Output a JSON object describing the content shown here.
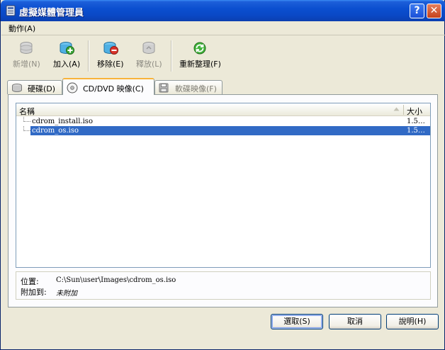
{
  "window": {
    "title": "虛擬媒體管理員",
    "help_glyph": "?",
    "close_glyph": "✕"
  },
  "menu": {
    "action": "動作(A)"
  },
  "toolbar": {
    "new": "新增(N)",
    "add": "加入(A)",
    "remove": "移除(E)",
    "release": "釋放(L)",
    "refresh": "重新整理(F)"
  },
  "tabs": {
    "hard_disks": "硬碟(D)",
    "cd_dvd": "CD/DVD 映像(C)",
    "floppy": "軟碟映像(F)"
  },
  "list": {
    "headers": {
      "name": "名稱",
      "size": "大小"
    },
    "rows": [
      {
        "name": "cdrom_install.iso",
        "size": "1.5…"
      },
      {
        "name": "cdrom_os.iso",
        "size": "1.5…"
      }
    ]
  },
  "info": {
    "location_label": "位置:",
    "location_value": "C:\\Sun\\user\\Images\\cdrom_os.iso",
    "attached_label": "附加到:",
    "attached_value": "未附加"
  },
  "buttons": {
    "select": "選取(S)",
    "cancel": "取消",
    "help": "說明(H)"
  },
  "colors": {
    "titlebar": "#0a49c7",
    "selection": "#316ac5",
    "face": "#ece9d8",
    "active_tab_accent": "#f8b33a"
  }
}
